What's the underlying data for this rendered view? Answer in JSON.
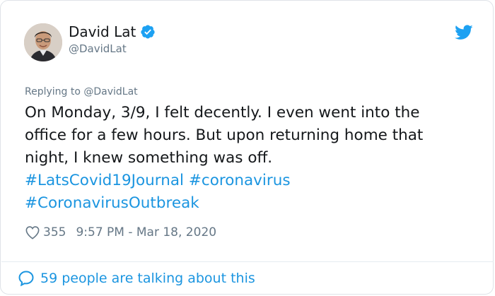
{
  "author": {
    "display_name": "David Lat",
    "handle": "@DavidLat",
    "verified_icon": "verified-badge-icon",
    "avatar_icon": "avatar"
  },
  "platform_icon": "twitter-bird-icon",
  "reply": {
    "text": "Replying to @DavidLat"
  },
  "tweet": {
    "lines": [
      "On Monday, 3/9, I felt decently. I even went into the",
      "office for a few hours. But upon returning home that",
      "night, I knew something was off."
    ],
    "hashtags": [
      "#LatsCovid19Journal",
      "#coronavirus",
      "#CoronavirusOutbreak"
    ]
  },
  "meta": {
    "like_icon": "heart-icon",
    "likes": "355",
    "timestamp": "9:57 PM - Mar 18, 2020"
  },
  "conversation": {
    "icon": "speech-bubble-icon",
    "text": "59 people are talking about this"
  },
  "colors": {
    "text": "#14171a",
    "muted": "#657786",
    "link": "#1b95e0"
  }
}
